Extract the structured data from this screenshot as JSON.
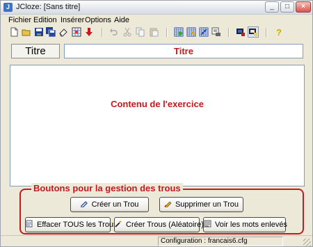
{
  "window": {
    "title": "JCloze: [Sans titre]",
    "app_icon_letter": "J"
  },
  "menubar": {
    "items": [
      "Fichier",
      "Edition",
      "Insérer",
      "Options",
      "Aide"
    ]
  },
  "toolbar": {
    "icons": [
      "new-icon",
      "open-icon",
      "save-icon",
      "save-all-icon",
      "eraser-icon",
      "grid-icon",
      "down-arrow-icon",
      "undo-icon",
      "cut-icon",
      "copy-icon",
      "paste-icon",
      "export-web-icon",
      "export-drag-icon",
      "export-ie-icon",
      "export-print-icon",
      "config-icon",
      "view-icon",
      "help-icon"
    ]
  },
  "header": {
    "label": "Titre",
    "title_value": "Titre"
  },
  "content": {
    "placeholder": "Contenu de l'exercice"
  },
  "gaps": {
    "legend": "Boutons pour la gestion des trous",
    "create_label": "Créer un Trou",
    "delete_label": "Supprimer un Trou",
    "clear_all_label": "Effacer TOUS les Trous",
    "create_random_label": "Créer Trous (Aléatoire)",
    "show_removed_label": "Voir les mots enlevés"
  },
  "statusbar": {
    "config": "Configuration : francais6.cfg"
  },
  "colors": {
    "accent": "#c8171d",
    "face": "#ece9d8"
  }
}
